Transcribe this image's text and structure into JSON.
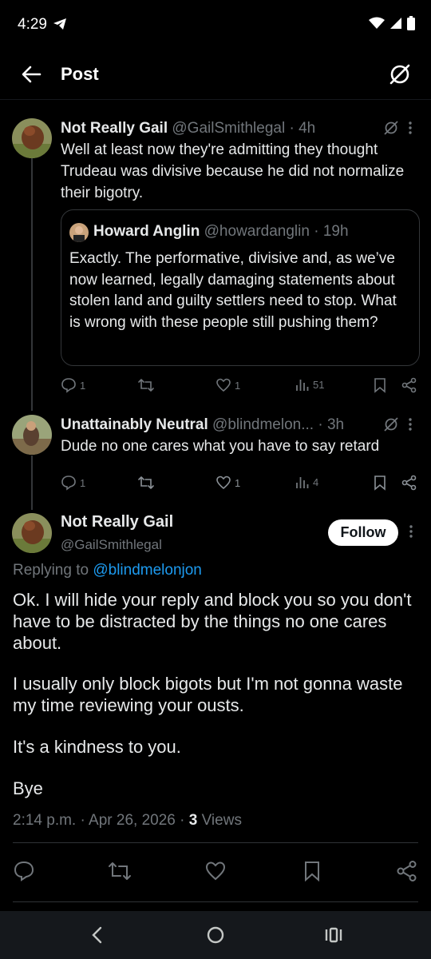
{
  "status_bar": {
    "time": "4:29"
  },
  "header": {
    "title": "Post"
  },
  "replies": [
    {
      "name": "Not Really Gail",
      "handle": "@GailSmithlegal",
      "time": "4h",
      "text": "Well at least now they're admitting they thought Trudeau was divisive because he did not normalize their bigotry.",
      "quote": {
        "name": "Howard Anglin",
        "handle": "@howardanglin",
        "time": "19h",
        "text": "Exactly. The performative, divisive and, as we’ve now learned, legally damaging statements about stolen land and guilty settlers need to stop. What is wrong with these people still pushing them?"
      },
      "stats": {
        "replies": "1",
        "likes": "1",
        "views": "51"
      }
    },
    {
      "name": "Unattainably Neutral",
      "handle": "@blindmelon...",
      "time": "3h",
      "text": "Dude no one cares what you have to say retard",
      "stats": {
        "replies": "1",
        "likes": "1",
        "views": "4"
      }
    }
  ],
  "main_post": {
    "name": "Not Really Gail",
    "handle": "@GailSmithlegal",
    "follow_label": "Follow",
    "replying_prefix": "Replying to ",
    "replying_handle": "@blindmelonjon",
    "paragraphs": [
      "Ok. I will hide your reply and block you so you don't have to be distracted  by the things no one cares about.",
      "I usually only block bigots but I'm not gonna waste my time reviewing your ousts.",
      "It's a kindness to you.",
      "Bye"
    ],
    "timestamp": "2:14 p.m. · Apr 26, 2026 · ",
    "views_count": "3",
    "views_label": " Views"
  },
  "colors": {
    "background": "#000000",
    "text": "#e7e9ea",
    "muted": "#71767b",
    "link": "#1d9bf0",
    "border": "#2f3336"
  }
}
